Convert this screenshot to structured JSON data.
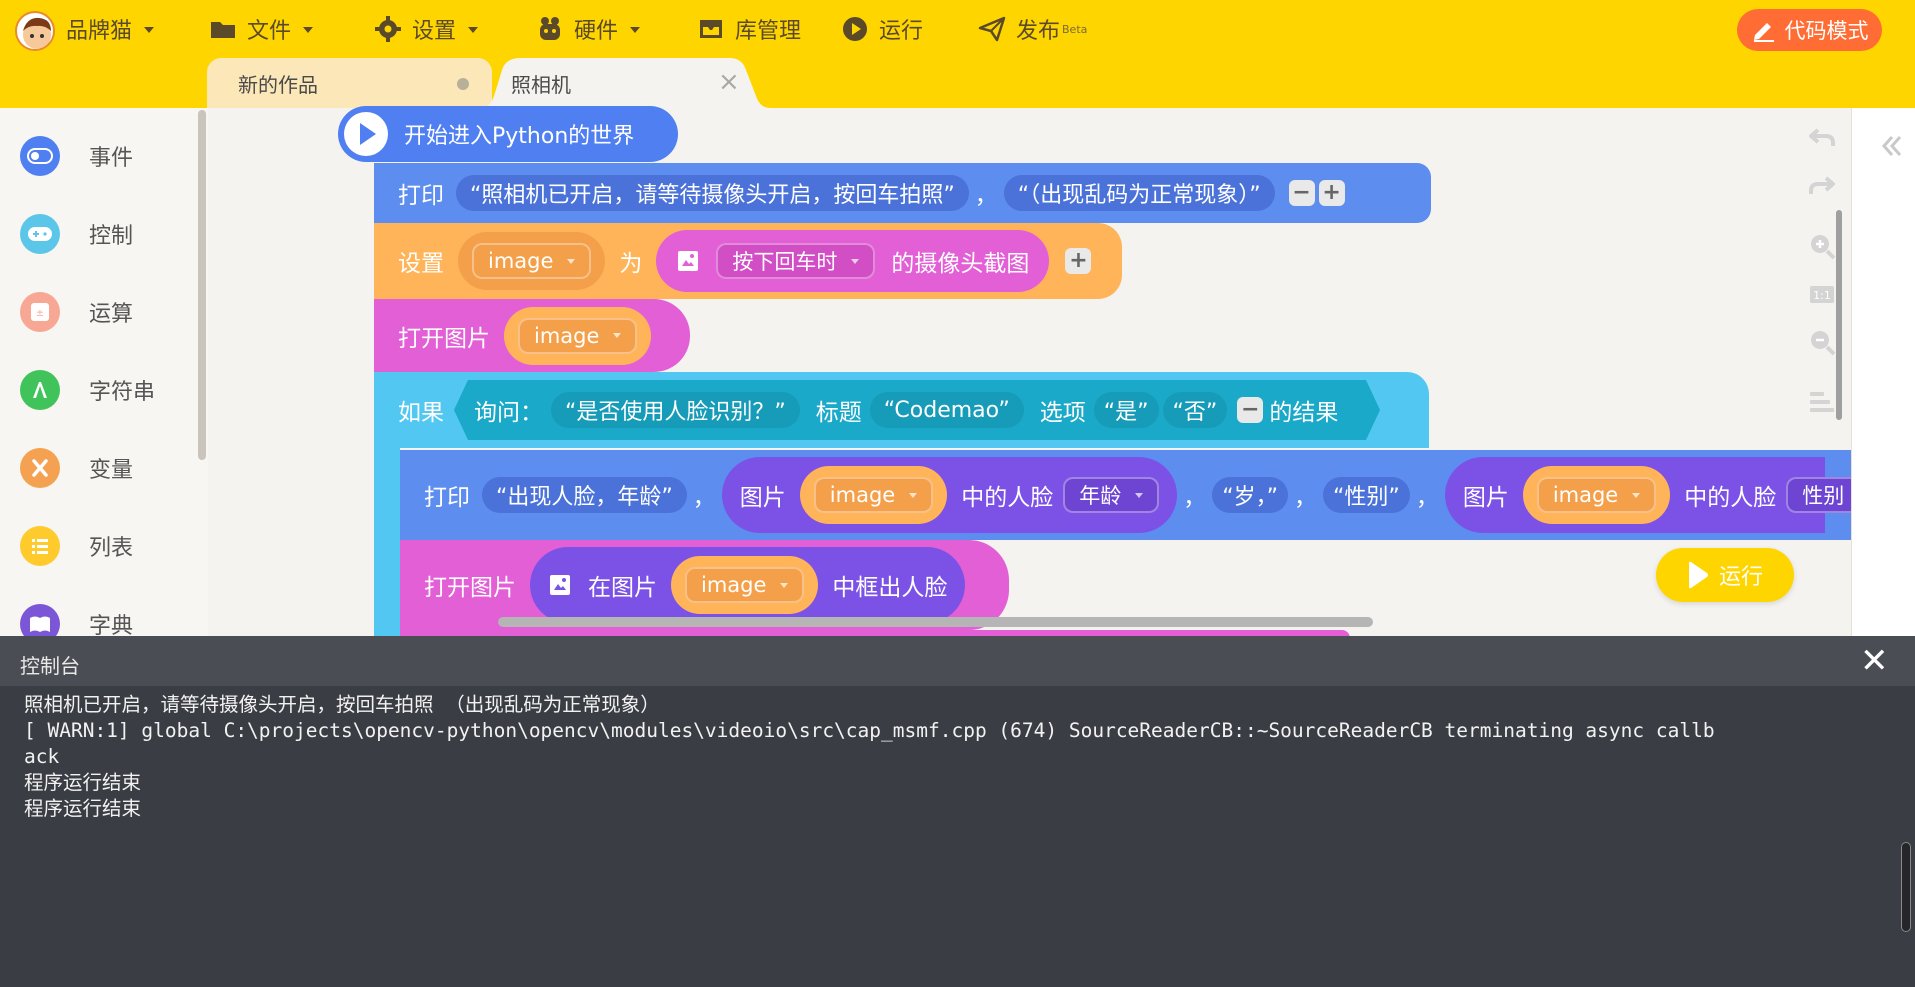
{
  "app": {
    "brand_label": "品牌猫",
    "menus": {
      "file": "文件",
      "settings": "设置",
      "hardware": "硬件",
      "library": "库管理",
      "run": "运行",
      "publish": "发布",
      "publish_badge": "Beta"
    },
    "code_mode_button": "代码模式",
    "accent_color": "#ffd500"
  },
  "tabs": [
    {
      "label": "新的作品",
      "state": "unsaved"
    },
    {
      "label": "照相机",
      "state": "active"
    }
  ],
  "sidebar": {
    "categories": [
      {
        "label": "事件",
        "icon": "toggle-icon",
        "color": "#4f7ff0"
      },
      {
        "label": "控制",
        "icon": "gamepad-icon",
        "color": "#5cc6e8"
      },
      {
        "label": "运算",
        "icon": "calculator-icon",
        "color": "#f7a794"
      },
      {
        "label": "字符串",
        "icon": "string-icon",
        "color": "#3fc35a"
      },
      {
        "label": "变量",
        "icon": "variable-icon",
        "color": "#f4a251"
      },
      {
        "label": "列表",
        "icon": "list-icon",
        "color": "#ffca2c"
      },
      {
        "label": "字典",
        "icon": "book-icon",
        "color": "#7b56d6"
      }
    ]
  },
  "blocks": {
    "start": {
      "label": "开始进入Python的世界"
    },
    "print1": {
      "keyword": "打印",
      "arg1": "“照相机已开启，请等待摄像头开启，按回车拍照”",
      "comma": "，",
      "arg2": "“（出现乱码为正常现象）”"
    },
    "set": {
      "keyword": "设置",
      "var": "image",
      "as": "为",
      "trigger": "按下回车时",
      "suffix": "的摄像头截图"
    },
    "open1": {
      "keyword": "打开图片",
      "var": "image"
    },
    "if": {
      "keyword": "如果",
      "ask": "询问：",
      "question": "“是否使用人脸识别？”",
      "title_label": "标题",
      "title_value": "“Codemao”",
      "options_label": "选项",
      "option1": "“是”",
      "option2": "“否”",
      "result": "的结果"
    },
    "print2": {
      "keyword": "打印",
      "arg1": "“出现人脸，年龄”",
      "comma": "，",
      "img_label": "图片",
      "var": "image",
      "face_label": "中的人脸",
      "attr1": "年龄",
      "arg2": "“岁，”",
      "arg3": "“性别”",
      "attr2": "性别"
    },
    "open2": {
      "keyword": "打开图片",
      "in_label": "在图片",
      "var": "image",
      "suffix": "中框出人脸"
    }
  },
  "workspace": {
    "run_button": "运行"
  },
  "console": {
    "title": "控制台",
    "lines": [
      "照相机已开启，请等待摄像头开启，按回车拍照 （出现乱码为正常现象）",
      "[ WARN:1] global C:\\projects\\opencv-python\\opencv\\modules\\videoio\\src\\cap_msmf.cpp (674) SourceReaderCB::~SourceReaderCB terminating async callb",
      "ack",
      "程序运行结束",
      "程序运行结束"
    ]
  }
}
